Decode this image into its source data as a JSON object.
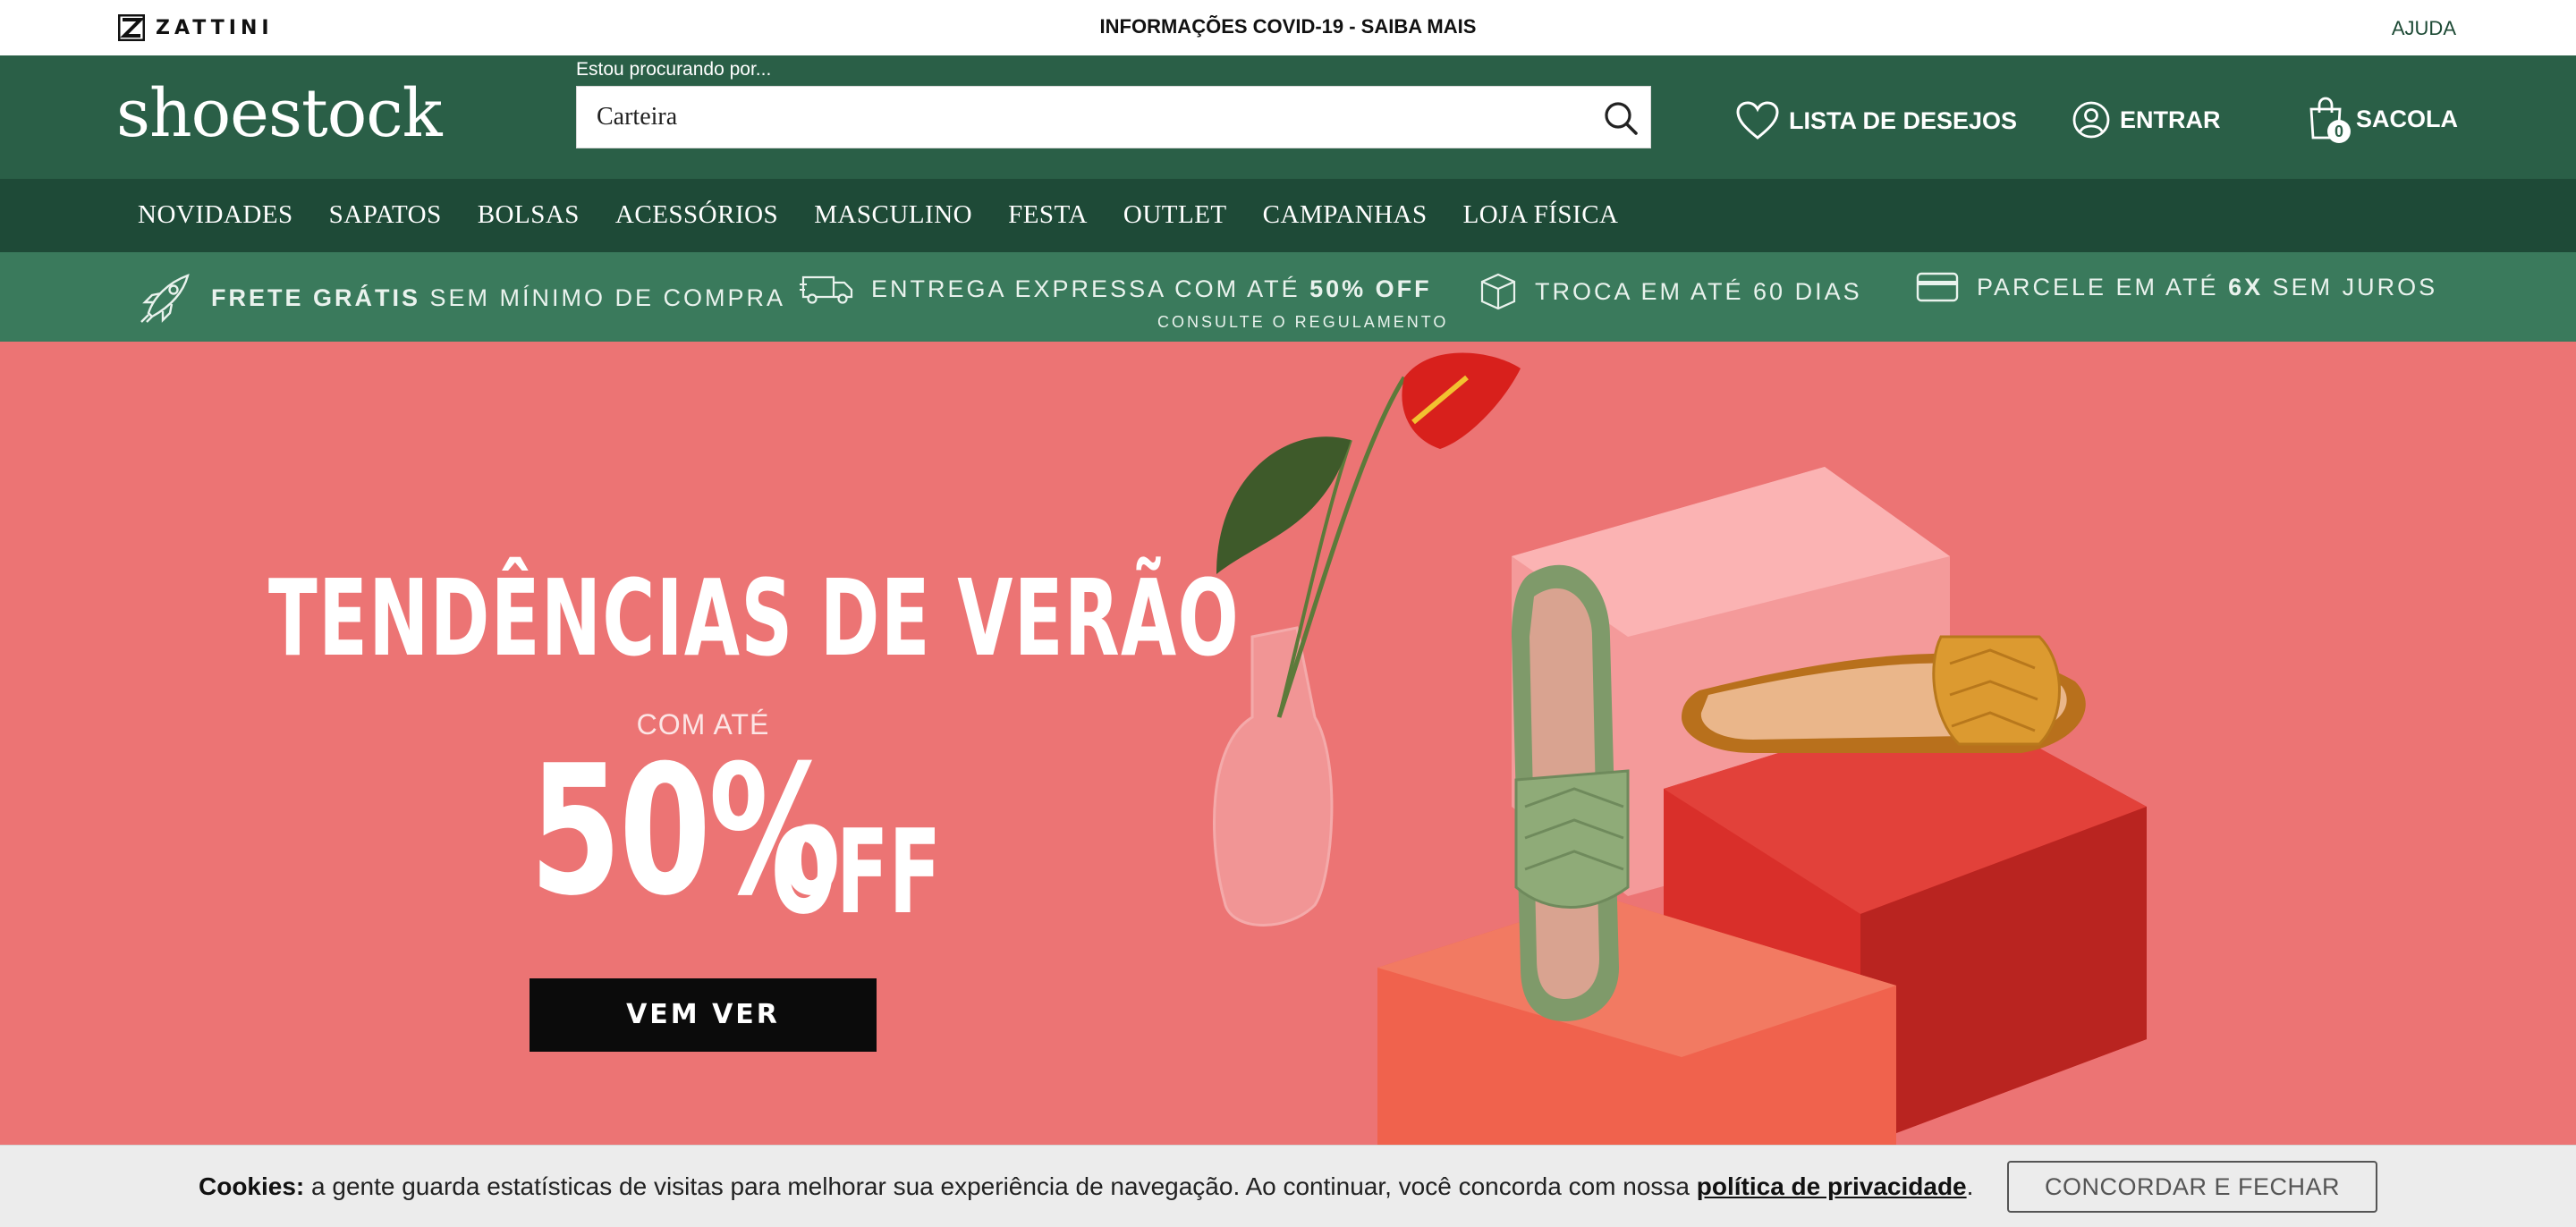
{
  "topbar": {
    "brand": "ZATTINI",
    "announcement": "INFORMAÇÕES COVID-19 - SAIBA MAIS",
    "help": "AJUDA"
  },
  "header": {
    "logo": "shoestock",
    "search": {
      "caption": "Estou procurando por...",
      "value": "Carteira"
    },
    "wishlist": "LISTA DE DESEJOS",
    "login": "ENTRAR",
    "bag": "SACOLA",
    "bag_count": "0"
  },
  "nav": {
    "items": [
      "NOVIDADES",
      "SAPATOS",
      "BOLSAS",
      "ACESSÓRIOS",
      "MASCULINO",
      "FESTA",
      "OUTLET",
      "CAMPANHAS",
      "LOJA FÍSICA"
    ]
  },
  "benefits": {
    "b1_bold": "FRETE GRÁTIS",
    "b1_rest": " SEM MÍNIMO DE COMPRA",
    "b2_lead": "ENTREGA EXPRESSA COM ATÉ ",
    "b2_bold": "50% OFF",
    "b2_sub": "CONSULTE O REGULAMENTO",
    "b3": "TROCA EM ATÉ 60 DIAS",
    "b4_lead": "PARCELE EM ATÉ ",
    "b4_bold": "6X",
    "b4_rest": " SEM JUROS"
  },
  "hero": {
    "title": "TENDÊNCIAS DE VERÃO",
    "sub": "COM ATÉ",
    "percent": "50%",
    "off": "OFF",
    "cta": "VEM VER",
    "bg_color": "#ec7474"
  },
  "cookie": {
    "lead": "Cookies:",
    "text": " a gente guarda estatísticas de visitas para melhorar sua experiência de navegação. Ao continuar, você concorda com nossa ",
    "policy": "política de privacidade",
    "end": ".",
    "button": "CONCORDAR E FECHAR"
  },
  "colors": {
    "header": "#2a5f47",
    "nav": "#1e4a37",
    "benefits": "#3a7a5c"
  },
  "icons": [
    "zattini-logo-icon",
    "search-icon",
    "heart-icon",
    "user-icon",
    "bag-icon",
    "rocket-icon",
    "truck-icon",
    "box-icon",
    "card-icon"
  ]
}
